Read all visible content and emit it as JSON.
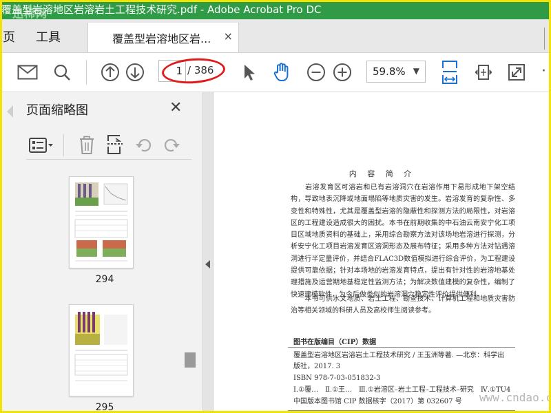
{
  "window": {
    "title": "覆盖型岩溶地区岩溶岩土工程技术研究.pdf - Adobe Acrobat Pro DC",
    "watermark_top": "迅稀网"
  },
  "menu": {
    "home": "页",
    "tools": "工具"
  },
  "tab": {
    "label": "覆盖型岩溶地区岩...",
    "close": "×"
  },
  "toolbar": {
    "page_current": "1",
    "page_total": "/ 386",
    "zoom": "59.8%",
    "zoom_arrow": "▼",
    "more": "·"
  },
  "left_panel": {
    "title": "页面缩略图",
    "close": "✕",
    "thumbnails": [
      {
        "page": "294"
      },
      {
        "page": "295"
      }
    ]
  },
  "document": {
    "heading": "内 容 简 介",
    "paragraph1": "　　岩溶发育区可溶岩和已有岩溶洞穴在岩溶作用下易形成地下架空结构，导致地表沉降或地面塌陷等地质灾害的发生。岩溶发育的复杂性、多变性和特殊性，尤其是覆盖型岩溶的隐蔽性和探测方法的局限性，对岩溶区的工程建设造成很大的困扰。本书在前期收集的中石油云南安宁化工项目区域地质资料的基础上，采用综合勘察方法对该场地岩溶进行探测，分析安宁化工项目岩溶发育区溶洞形态及展布特征；采用多种方法对钻遇溶洞进行半定量评价，并结合FLAC3D数值模拟进行综合评价，为工程建设提供可靠依据；针对本场地的岩溶发育特点，提出有针对性的岩溶地基处理措施及运营期地基稳定性监测方法；为解决数值建模的复杂性，编制了快速建模软件，为今后做类似的岩溶洞穴稳定性评价提供便利。",
    "paragraph2": "　　本书可供水文地质、岩土工程、勘查技术、计算机工程和地质灾害防治等相关领域的科研人员及高校师生阅读参考。",
    "cip_title": "图书在版编目（CIP）数据",
    "cip_line1": "覆盖型岩溶地区岩溶岩土工程技术研究 / 王玉洲等著. —北京：科学出",
    "cip_line2": "版社，2017. 3",
    "cip_isbn": "ISBN 978-7-03-051832-3",
    "cip_class": "Ⅰ.①覆…　Ⅱ.①王…　Ⅲ.①岩溶区–岩土工程–工程技术–研究　Ⅳ.①TU4",
    "cip_number": "中国版本图书馆 CIP 数据核字（2017）第 032607 号"
  },
  "watermark_bottom": "www.cndao.com"
}
